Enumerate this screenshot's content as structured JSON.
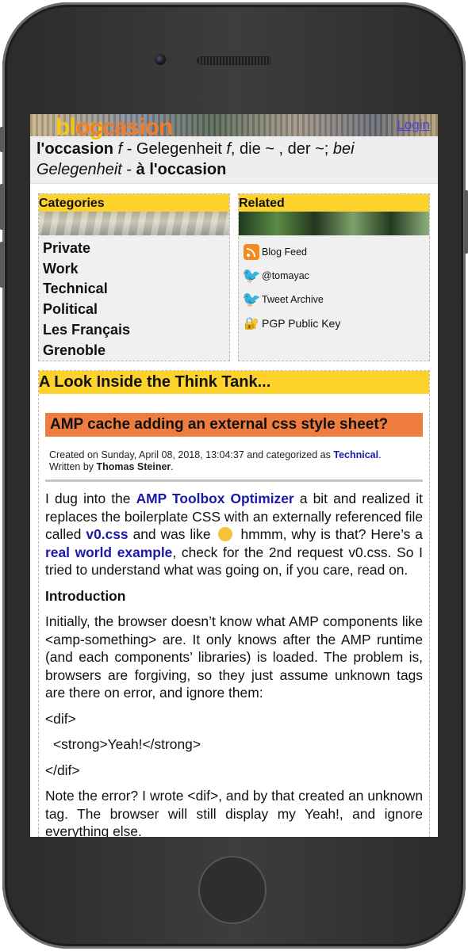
{
  "header": {
    "logo_part1": "blog",
    "logo_part2": "occasion",
    "login": "Login"
  },
  "tagline": {
    "word": "l'occasion",
    "g1": "f",
    "t1": " - Gelegenheit ",
    "g2": "f",
    "t2": ", die ~ , der ~; ",
    "phrase": "bei Gelegenheit",
    "t3": " - ",
    "result": "à l'occasion"
  },
  "categories": {
    "title": "Categories",
    "items": [
      "Private",
      "Work",
      "Technical",
      "Political",
      "Les Français",
      "Grenoble"
    ]
  },
  "related": {
    "title": "Related",
    "items": [
      {
        "label": "Blog Feed",
        "icon": "rss-icon"
      },
      {
        "label": "@tomayac",
        "icon": "twitter-icon"
      },
      {
        "label": "Tweet Archive",
        "icon": "twitter-icon"
      },
      {
        "label": "PGP Public Key",
        "icon": "lock-icon"
      }
    ]
  },
  "section_title": "A Look Inside the Think Tank...",
  "post": {
    "title": "AMP cache adding an external css style sheet?",
    "meta_prefix": "Created on Sunday, April 08, 2018, 13:04:37 and categorized as ",
    "category": "Technical",
    "meta_mid": ".",
    "written_by": "Written by ",
    "author": "Thomas Steiner",
    "author_suffix": ".",
    "p1_a": "I dug into the ",
    "link1": "AMP Toolbox Optimizer",
    "p1_b": " a bit and realized it replaces the boilerplate CSS with an externally referenced file called ",
    "link2": "v0.css",
    "p1_c": " and was like ",
    "p1_d": " hmmm, why is that? Here’s a ",
    "link3": "real world example",
    "p1_e": ", check for the 2nd request v0.css. So I tried to understand what was going on, if you care, read on.",
    "h_intro": "Introduction",
    "p2": "Initially, the browser doesn’t know what AMP components like <amp-something> are. It only knows after the AMP runtime (and each components’ libraries) is loaded. The problem is, browsers are forgiving, so they just assume unknown tags are there on error, and ignore them:",
    "code1": "<dif>",
    "code2": "<strong>Yeah!</strong>",
    "code3": "</dif>",
    "p3": "Note the error? I wrote <dif>, and by that created an unknown tag. The browser will still display my Yeah!, and ignore everything else."
  },
  "colors": {
    "accent_yellow": "#fcd22b",
    "accent_orange": "#f07d40",
    "link_blue": "#1a1aa8"
  }
}
